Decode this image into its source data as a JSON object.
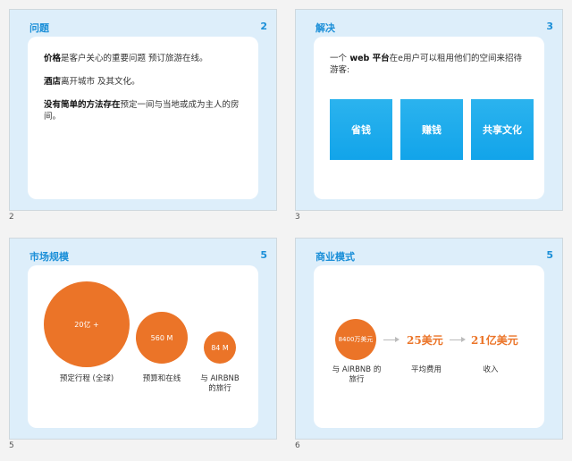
{
  "slides": [
    {
      "id": "2",
      "title": "问题",
      "number": "2",
      "below": "2",
      "paragraphs": [
        {
          "bold": "价格",
          "text": "是客户关心的重要问题 预订旅游在线。"
        },
        {
          "bold": "酒店",
          "text": "离开城市 及其文化。"
        },
        {
          "bold": "没有简单的方法存在",
          "text": "预定一间与当地或成为主人的房间。"
        }
      ]
    },
    {
      "id": "3",
      "title": "解决",
      "number": "3",
      "below": "3",
      "line_prefix": "一个",
      "line_bold": " web 平台",
      "line_rest": "在e用户可以租用他们的空间来招待游客:",
      "boxes": [
        "省钱",
        "赚钱",
        "共享文化"
      ]
    },
    {
      "id": "5",
      "title": "市场规模",
      "number": "5",
      "below": "5",
      "circles": [
        {
          "value": "20亿 +",
          "caption": "预定行程 (全球)"
        },
        {
          "value": "560 M",
          "caption": "预算和在线"
        },
        {
          "value": "84 M",
          "caption": "与 AIRBNB 的旅行"
        }
      ]
    },
    {
      "id": "6",
      "title": "商业模式",
      "number": "5",
      "below": "6",
      "circle_value": "8400万美元",
      "metric1": "25美元",
      "metric2": "21亿美元",
      "cap1": "与 AIRBNB 的旅行",
      "cap2": "平均费用",
      "cap3": "收入"
    }
  ]
}
